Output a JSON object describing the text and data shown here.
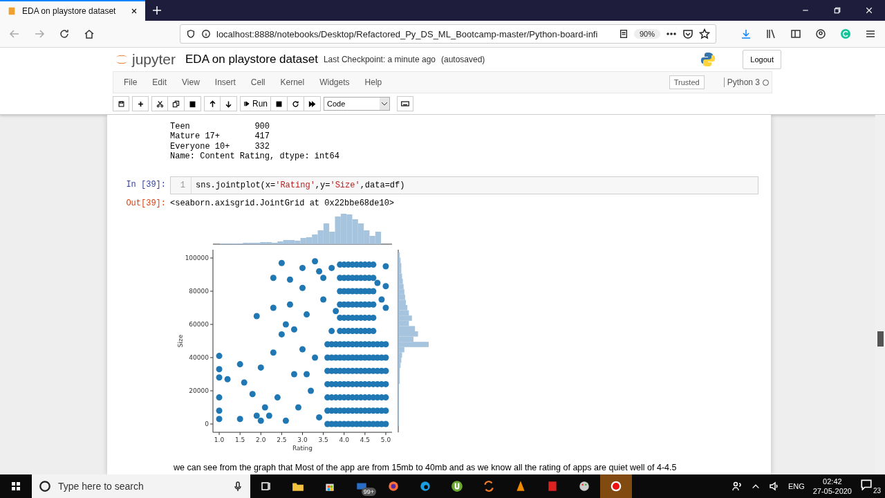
{
  "browser": {
    "tabs": [
      {
        "title": "EDA on playstore dataset",
        "selected": true
      }
    ],
    "url": "localhost:8888/notebooks/Desktop/Refactored_Py_DS_ML_Bootcamp-master/Python-board-infi",
    "zoom": "90%"
  },
  "notebook": {
    "logo_text": "jupyter",
    "title": "EDA on playstore dataset",
    "checkpoint": "Last Checkpoint: a minute ago",
    "save_status": "(autosaved)",
    "logout": "Logout",
    "menu": [
      "File",
      "Edit",
      "View",
      "Insert",
      "Cell",
      "Kernel",
      "Widgets",
      "Help"
    ],
    "trusted": "Trusted",
    "kernel": "Python 3",
    "run": "Run",
    "cell_type": "Code"
  },
  "cells": [
    {
      "kind": "output",
      "lines": [
        "Teen             900",
        "Mature 17+       417",
        "Everyone 10+     332",
        "Name: Content Rating, dtype: int64"
      ]
    },
    {
      "kind": "code",
      "prompt": "In [39]:",
      "line_number": "1",
      "tokens": [
        {
          "text": "sns.jointplot(x=",
          "kind": "plain"
        },
        {
          "text": "'Rating'",
          "kind": "string"
        },
        {
          "text": ",y=",
          "kind": "plain"
        },
        {
          "text": "'Size'",
          "kind": "string"
        },
        {
          "text": ",data=df)",
          "kind": "plain"
        }
      ]
    },
    {
      "kind": "output",
      "prompt": "Out[39]:",
      "lines": [
        "<seaborn.axisgrid.JointGrid at 0x22bbe68de10>"
      ]
    },
    {
      "kind": "plot",
      "chart_data": {
        "type": "scatter",
        "xlabel": "Rating",
        "ylabel": "Size",
        "xlim": [
          0.85,
          5.15
        ],
        "ylim": [
          -5000,
          105000
        ],
        "xticks": [
          {
            "value": 1,
            "label": "1.0"
          },
          {
            "value": 1.5,
            "label": "1.5"
          },
          {
            "value": 2,
            "label": "2.0"
          },
          {
            "value": 2.5,
            "label": "2.5"
          },
          {
            "value": 3,
            "label": "3.0"
          },
          {
            "value": 3.5,
            "label": "3.5"
          },
          {
            "value": 4,
            "label": "4.0"
          },
          {
            "value": 4.5,
            "label": "4.5"
          },
          {
            "value": 5,
            "label": "5.0"
          }
        ],
        "yticks": [
          0,
          20000,
          40000,
          60000,
          80000,
          100000
        ],
        "x": [
          3.6,
          3.7,
          3.8,
          3.9,
          4.0,
          4.1,
          4.2,
          4.3,
          4.4,
          4.5,
          4.6,
          4.7,
          4.8,
          4.9,
          5.0,
          3.6,
          3.7,
          3.8,
          3.9,
          4.0,
          4.1,
          4.2,
          4.3,
          4.4,
          4.5,
          4.6,
          4.7,
          4.8,
          4.9,
          5.0,
          3.6,
          3.7,
          3.8,
          3.9,
          4.0,
          4.1,
          4.2,
          4.3,
          4.4,
          4.5,
          4.6,
          4.7,
          4.8,
          4.9,
          5.0,
          3.6,
          3.7,
          3.8,
          3.9,
          4.0,
          4.1,
          4.2,
          4.3,
          4.4,
          4.5,
          4.6,
          4.7,
          4.8,
          4.9,
          5.0,
          3.6,
          3.7,
          3.8,
          3.9,
          4.0,
          4.1,
          4.2,
          4.3,
          4.4,
          4.5,
          4.6,
          4.7,
          4.8,
          4.9,
          5.0,
          3.6,
          3.7,
          3.8,
          3.9,
          4.0,
          4.1,
          4.2,
          4.3,
          4.4,
          4.5,
          4.6,
          4.7,
          4.8,
          4.9,
          5.0,
          3.6,
          3.7,
          3.8,
          3.9,
          4.0,
          4.1,
          4.2,
          4.3,
          4.4,
          4.5,
          4.6,
          4.7,
          4.8,
          4.9,
          5.0,
          3.9,
          4.0,
          4.1,
          4.2,
          4.3,
          4.4,
          4.5,
          4.6,
          4.7,
          3.9,
          4.0,
          4.1,
          4.2,
          4.3,
          4.4,
          4.5,
          4.6,
          4.7,
          3.9,
          4.0,
          4.1,
          4.2,
          4.3,
          4.4,
          4.5,
          4.6,
          4.7,
          3.9,
          4.0,
          4.1,
          4.2,
          4.3,
          4.4,
          4.5,
          4.6,
          4.7,
          3.9,
          4.0,
          4.1,
          4.2,
          4.3,
          4.4,
          4.5,
          4.6,
          4.7,
          3.9,
          4.0,
          4.1,
          4.2,
          4.3,
          4.4,
          4.5,
          4.6,
          4.7,
          1.0,
          1.0,
          1.0,
          1.0,
          1.0,
          1.0,
          1.2,
          1.5,
          1.5,
          1.6,
          1.8,
          1.9,
          1.9,
          2.0,
          2.1,
          2.3,
          2.3,
          2.3,
          2.4,
          2.5,
          2.5,
          2.6,
          2.7,
          2.7,
          2.8,
          3.0,
          3.0,
          3.1,
          3.0,
          2.8,
          2.6,
          2.9,
          3.2,
          3.3,
          3.4,
          3.5,
          3.3,
          3.5,
          3.4,
          3.1,
          5.0,
          5.0,
          5.0,
          4.9,
          4.8,
          3.7,
          3.8,
          3.7,
          2.2,
          2.0
        ],
        "series": [
          {
            "color": "#1f77b4",
            "values": [
              0,
              0,
              0,
              0,
              0,
              0,
              0,
              0,
              0,
              0,
              0,
              0,
              0,
              0,
              0,
              8000,
              8000,
              8000,
              8000,
              8000,
              8000,
              8000,
              8000,
              8000,
              8000,
              8000,
              8000,
              8000,
              8000,
              8000,
              16000,
              16000,
              16000,
              16000,
              16000,
              16000,
              16000,
              16000,
              16000,
              16000,
              16000,
              16000,
              16000,
              16000,
              16000,
              24000,
              24000,
              24000,
              24000,
              24000,
              24000,
              24000,
              24000,
              24000,
              24000,
              24000,
              24000,
              24000,
              24000,
              24000,
              32000,
              32000,
              32000,
              32000,
              32000,
              32000,
              32000,
              32000,
              32000,
              32000,
              32000,
              32000,
              32000,
              32000,
              32000,
              40000,
              40000,
              40000,
              40000,
              40000,
              40000,
              40000,
              40000,
              40000,
              40000,
              40000,
              40000,
              40000,
              40000,
              40000,
              48000,
              48000,
              48000,
              48000,
              48000,
              48000,
              48000,
              48000,
              48000,
              48000,
              48000,
              48000,
              48000,
              48000,
              48000,
              56000,
              56000,
              56000,
              56000,
              56000,
              56000,
              56000,
              56000,
              56000,
              64000,
              64000,
              64000,
              64000,
              64000,
              64000,
              64000,
              64000,
              64000,
              72000,
              72000,
              72000,
              72000,
              72000,
              72000,
              72000,
              72000,
              72000,
              80000,
              80000,
              80000,
              80000,
              80000,
              80000,
              80000,
              80000,
              80000,
              88000,
              88000,
              88000,
              88000,
              88000,
              88000,
              88000,
              88000,
              88000,
              96000,
              96000,
              96000,
              96000,
              96000,
              96000,
              96000,
              96000,
              96000,
              41000,
              33000,
              28000,
              16000,
              8000,
              3000,
              27000,
              36000,
              3000,
              25000,
              18000,
              65000,
              5000,
              34000,
              10000,
              88000,
              70000,
              43000,
              16000,
              97000,
              54000,
              60000,
              87000,
              72000,
              57000,
              94000,
              82000,
              66000,
              45000,
              30000,
              2000,
              10000,
              20000,
              98000,
              92000,
              88000,
              40000,
              75000,
              4000,
              30000,
              95000,
              83000,
              70000,
              75000,
              85000,
              94000,
              68000,
              56000,
              5000,
              2000
            ]
          }
        ]
      }
    },
    {
      "kind": "markdown",
      "text": "we can see from the graph that Most of the app are from 15mb to 40mb and as we know all the rating of apps are quiet well of 4-4.5"
    }
  ],
  "taskbar": {
    "search_placeholder": "Type here to search",
    "badge": "99+",
    "language": "ENG",
    "time": "02:42",
    "date": "27-05-2020",
    "notifications": "23"
  }
}
